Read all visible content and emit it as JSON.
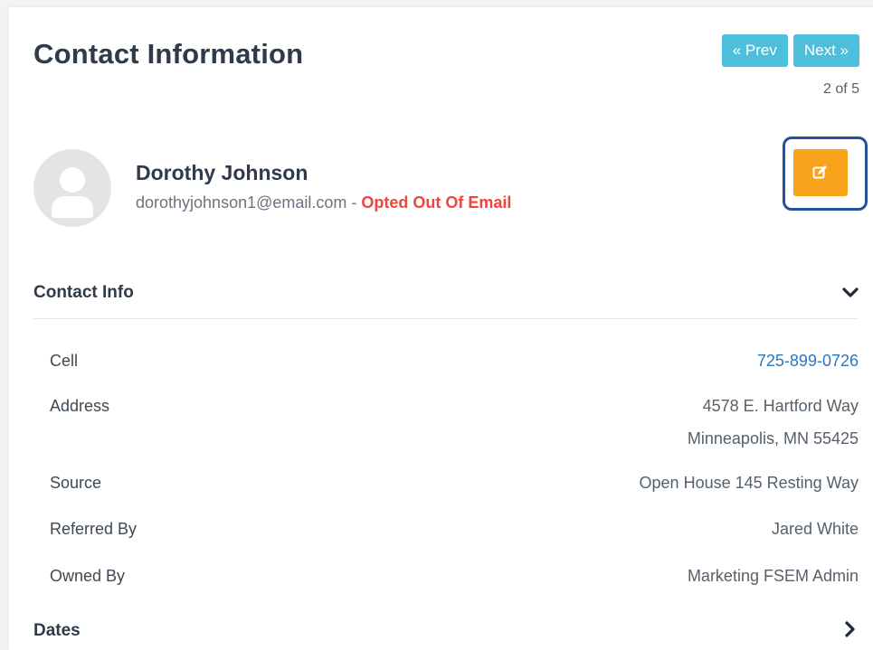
{
  "header": {
    "title": "Contact Information",
    "prev_label": "« Prev",
    "next_label": "Next »",
    "page_count": "2 of 5"
  },
  "contact": {
    "name": "Dorothy Johnson",
    "email": "dorothyjohnson1@email.com",
    "separator": " - ",
    "email_status": "Opted Out Of Email"
  },
  "sections": {
    "contact_info": "Contact Info",
    "dates": "Dates"
  },
  "details": {
    "cell_label": "Cell",
    "cell_value": "725-899-0726",
    "address_label": "Address",
    "address_line1": "4578 E. Hartford Way",
    "address_line2": "Minneapolis, MN 55425",
    "source_label": "Source",
    "source_value": "Open House 145 Resting Way",
    "referred_label": "Referred By",
    "referred_value": "Jared White",
    "owned_label": "Owned By",
    "owned_value": "Marketing FSEM Admin"
  },
  "icons": {
    "avatar": "user-avatar-icon",
    "edit": "edit-icon",
    "contact_info_toggle": "chevron-down-icon",
    "dates_toggle": "chevron-right-icon"
  },
  "colors": {
    "pager_button": "#4cbfdc",
    "edit_button": "#f7a31c",
    "edit_highlight": "#24509c",
    "opted_out": "#f0453f",
    "link": "#2a78bd",
    "heading": "#2f3b4a"
  }
}
